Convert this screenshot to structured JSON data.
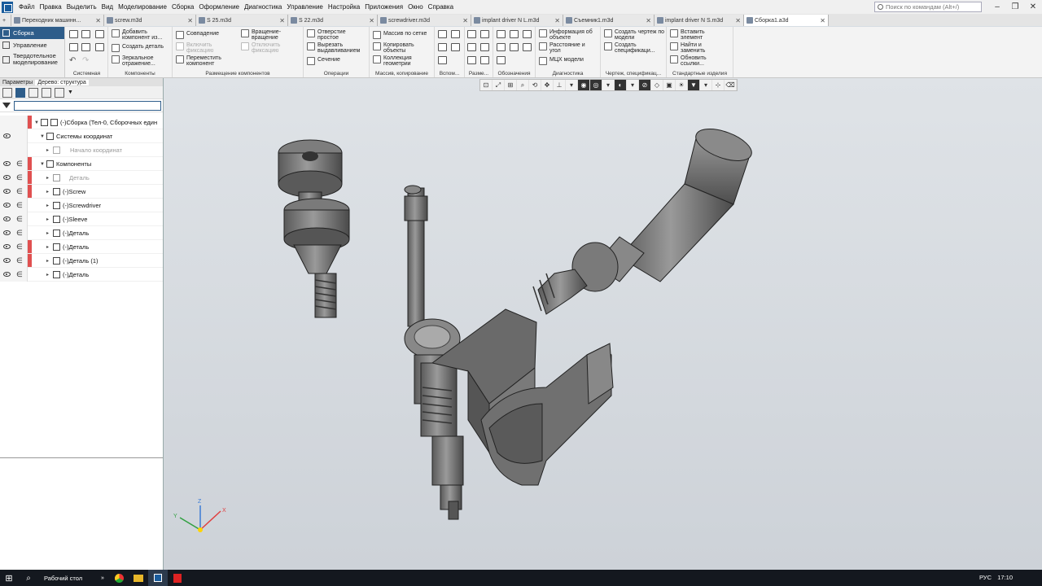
{
  "menu": [
    "Файл",
    "Правка",
    "Выделить",
    "Вид",
    "Моделирование",
    "Сборка",
    "Оформление",
    "Диагностика",
    "Управление",
    "Настройка",
    "Приложения",
    "Окно",
    "Справка"
  ],
  "search": {
    "placeholder": "Поиск по командам (Alt+/)"
  },
  "tabs": [
    {
      "label": "Переходник машинн..."
    },
    {
      "label": "screw.m3d"
    },
    {
      "label": "S 25.m3d"
    },
    {
      "label": "S 22.m3d"
    },
    {
      "label": "screwdriver.m3d"
    },
    {
      "label": "implant driver N L.m3d"
    },
    {
      "label": "Съемник1.m3d"
    },
    {
      "label": "implant driver N S.m3d"
    },
    {
      "label": "Сборка1.a3d",
      "active": true
    }
  ],
  "nav": [
    {
      "label": "Сборка",
      "active": true
    },
    {
      "label": "Управление"
    },
    {
      "label": "Твердотельное моделирование"
    }
  ],
  "ribbon": {
    "groups": [
      "Системная",
      "Компоненты",
      "Размещение компонентов",
      "Операции",
      "Массив, копирование",
      "Вспом...",
      "Разме...",
      "Обозначения",
      "Диагностика",
      "Чертеж, спецификац...",
      "Стандартные изделия"
    ],
    "commands": {
      "add_component": "Добавить компонент из...",
      "create_part": "Создать деталь",
      "mirror": "Зеркальное отражение...",
      "coincidence": "Совпадение",
      "enable_fix": "Включить фиксацию",
      "move_component": "Переместить компонент",
      "rotation": "Вращение-вращение",
      "disable_fix": "Отключить фиксацию",
      "hole": "Отверстие простое",
      "cut_extrude": "Вырезать выдавливанием",
      "section": "Сечение",
      "grid_array": "Массив по сетке",
      "copy_objects": "Копировать объекты",
      "geometry_collection": "Коллекция геометрии",
      "object_info": "Информация об объекте",
      "distance_angle": "Расстояние и угол",
      "mass_props": "МЦХ модели",
      "create_drawing": "Создать чертеж по модели",
      "create_spec": "Создать спецификаци...",
      "insert_element": "Вставить элемент",
      "find_replace": "Найти и заменить",
      "update_links": "Обновить ссылки..."
    }
  },
  "panel": {
    "tab_params": "Параметры",
    "tab_tree": "Дерево: структура"
  },
  "tree": [
    {
      "label": "(-)Сборка (Тел-0, Сборочных един",
      "level": 0
    },
    {
      "label": "Системы координат",
      "level": 1
    },
    {
      "label": "Начало координат",
      "level": 2,
      "dim": true
    },
    {
      "label": "Компоненты",
      "level": 1
    },
    {
      "label": "Деталь",
      "level": 2,
      "dim": true
    },
    {
      "label": "(-)Screw",
      "level": 2
    },
    {
      "label": "(-)Screwdriver",
      "level": 2
    },
    {
      "label": "(-)Sleeve",
      "level": 2
    },
    {
      "label": "(-)Деталь",
      "level": 2
    },
    {
      "label": "(-)Деталь",
      "level": 2
    },
    {
      "label": "(-)Деталь (1)",
      "level": 2
    },
    {
      "label": "(-)Деталь",
      "level": 2
    }
  ],
  "taskbar": {
    "desktop": "Рабочий стол",
    "lang": "РУС",
    "time": "17:10"
  },
  "axes": {
    "x": "X",
    "y": "Y",
    "z": "Z"
  }
}
